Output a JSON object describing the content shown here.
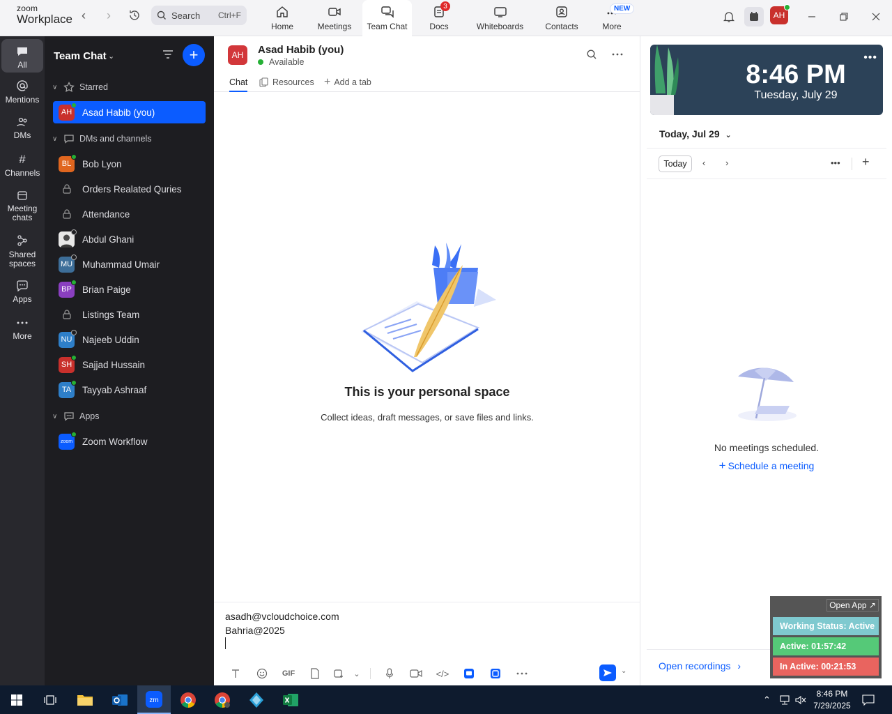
{
  "app": {
    "brand_top": "zoom",
    "brand_bottom": "Workplace",
    "search_label": "Search",
    "search_shortcut": "Ctrl+F",
    "tabs": [
      {
        "label": "Home",
        "icon": "home-icon"
      },
      {
        "label": "Meetings",
        "icon": "video-icon"
      },
      {
        "label": "Team Chat",
        "icon": "chat-icon",
        "active": true
      },
      {
        "label": "Docs",
        "icon": "docs-icon",
        "badge": "3"
      },
      {
        "label": "Whiteboards",
        "icon": "whiteboard-icon"
      },
      {
        "label": "Contacts",
        "icon": "contacts-icon"
      },
      {
        "label": "More",
        "icon": "more-icon",
        "badge": "NEW"
      }
    ],
    "avatar_initials": "AH"
  },
  "rail": [
    {
      "label": "All",
      "icon": "chat-bubble-icon",
      "active": true
    },
    {
      "label": "Mentions",
      "icon": "at-icon"
    },
    {
      "label": "DMs",
      "icon": "people-icon"
    },
    {
      "label": "Channels",
      "icon": "hash-icon"
    },
    {
      "label": "Meeting chats",
      "icon": "calendar-icon"
    },
    {
      "label": "Shared spaces",
      "icon": "share-icon"
    },
    {
      "label": "Apps",
      "icon": "apps-icon"
    },
    {
      "label": "More",
      "icon": "more-dots-icon"
    }
  ],
  "chatlist": {
    "title": "Team Chat",
    "sections": {
      "starred": "Starred",
      "dms": "DMs and channels",
      "apps": "Apps"
    },
    "starred_items": [
      {
        "initials": "AH",
        "name": "Asad Habib (you)",
        "color": "#c9302c",
        "status": "online"
      }
    ],
    "items": [
      {
        "initials": "BL",
        "name": "Bob Lyon",
        "color": "#e0661f",
        "status": "online",
        "type": "person"
      },
      {
        "name": "Orders Realated Quries",
        "type": "channel"
      },
      {
        "name": "Attendance",
        "type": "channel"
      },
      {
        "initials": "",
        "name": "Abdul Ghani",
        "color": "#bfbfbf",
        "status": "offline",
        "type": "photo"
      },
      {
        "initials": "MU",
        "name": "Muhammad Umair",
        "color": "#3d6e99",
        "status": "offline",
        "type": "person"
      },
      {
        "initials": "BP",
        "name": "Brian Paige",
        "color": "#8a3fc0",
        "status": "online",
        "type": "person"
      },
      {
        "name": "Listings Team",
        "type": "channel"
      },
      {
        "initials": "NU",
        "name": "Najeeb Uddin",
        "color": "#2e7fc9",
        "status": "offline",
        "type": "person"
      },
      {
        "initials": "SH",
        "name": "Sajjad Hussain",
        "color": "#c9302c",
        "status": "online",
        "type": "person"
      },
      {
        "initials": "TA",
        "name": "Tayyab Ashraaf",
        "color": "#2e7fc9",
        "status": "online",
        "type": "person"
      }
    ],
    "app_items": [
      {
        "initials": "zoom",
        "name": "Zoom Workflow",
        "color": "#0b5cff",
        "status": "online"
      }
    ]
  },
  "main": {
    "avatar_initials": "AH",
    "name": "Asad Habib (you)",
    "status": "Available",
    "tabs": [
      "Chat",
      "Resources",
      "Add a tab"
    ],
    "empty_title": "This is your personal space",
    "empty_sub": "Collect ideas, draft messages, or save files and links.",
    "draft_lines": [
      "asadh@vcloudchoice.com",
      "Bahria@2025"
    ],
    "gif_label": "GIF"
  },
  "right": {
    "clock_time": "8:46 PM",
    "clock_date": "Tuesday, July 29",
    "calendar_date": "Today, Jul 29",
    "today_btn": "Today",
    "no_meetings": "No meetings scheduled.",
    "schedule": "Schedule a meeting",
    "open_recordings": "Open recordings"
  },
  "widget": {
    "open_app": "Open App ↗",
    "working": "Working Status: Active",
    "active": "Active: 01:57:42",
    "inactive": "In Active: 00:21:53",
    "colors": {
      "working": "#7fc9cf",
      "active": "#55c978",
      "inactive": "#e9645f"
    }
  },
  "taskbar": {
    "time": "8:46 PM",
    "date": "7/29/2025"
  }
}
